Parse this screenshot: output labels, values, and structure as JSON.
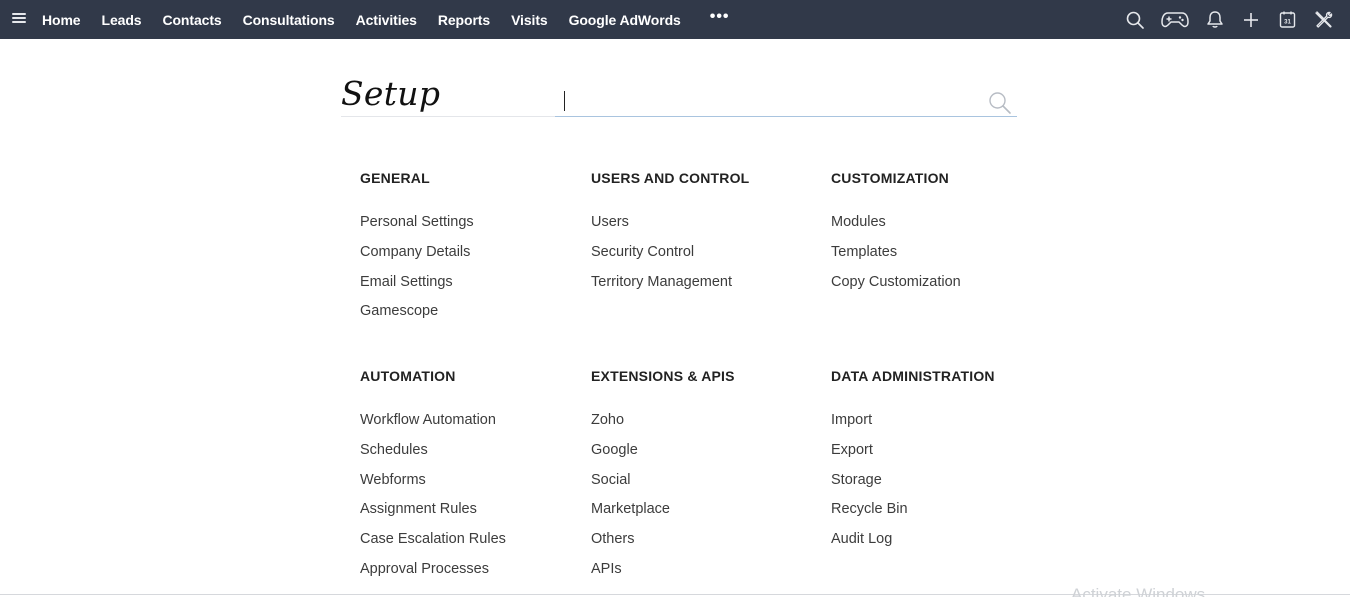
{
  "topbar": {
    "menu_icon": "hamburger-icon",
    "nav": [
      {
        "label": "Home"
      },
      {
        "label": "Leads"
      },
      {
        "label": "Contacts"
      },
      {
        "label": "Consultations"
      },
      {
        "label": "Activities"
      },
      {
        "label": "Reports"
      },
      {
        "label": "Visits"
      },
      {
        "label": "Google AdWords"
      }
    ],
    "more_label": "•••",
    "icons": [
      "search-icon",
      "gamepad-icon",
      "bell-icon",
      "plus-icon",
      "calendar-icon",
      "setup-tools-icon"
    ],
    "calendar_day": "31"
  },
  "page": {
    "title": "Setup",
    "search": {
      "value": "",
      "placeholder": ""
    }
  },
  "sections": [
    {
      "title": "GENERAL",
      "links": [
        "Personal Settings",
        "Company Details",
        "Email Settings",
        "Gamescope"
      ]
    },
    {
      "title": "USERS AND CONTROL",
      "links": [
        "Users",
        "Security Control",
        "Territory Management"
      ]
    },
    {
      "title": "CUSTOMIZATION",
      "links": [
        "Modules",
        "Templates",
        "Copy Customization"
      ]
    },
    {
      "title": "AUTOMATION",
      "links": [
        "Workflow Automation",
        "Schedules",
        "Webforms",
        "Assignment Rules",
        "Case Escalation Rules",
        "Approval Processes"
      ]
    },
    {
      "title": "EXTENSIONS & APIS",
      "links": [
        "Zoho",
        "Google",
        "Social",
        "Marketplace",
        "Others",
        "APIs"
      ]
    },
    {
      "title": "DATA ADMINISTRATION",
      "links": [
        "Import",
        "Export",
        "Storage",
        "Recycle Bin",
        "Audit Log"
      ]
    }
  ],
  "watermark": "Activate Windows",
  "colors": {
    "topbar": "#313949",
    "link_hover": "#0a67c2",
    "search_underline": "#a9c4df"
  }
}
